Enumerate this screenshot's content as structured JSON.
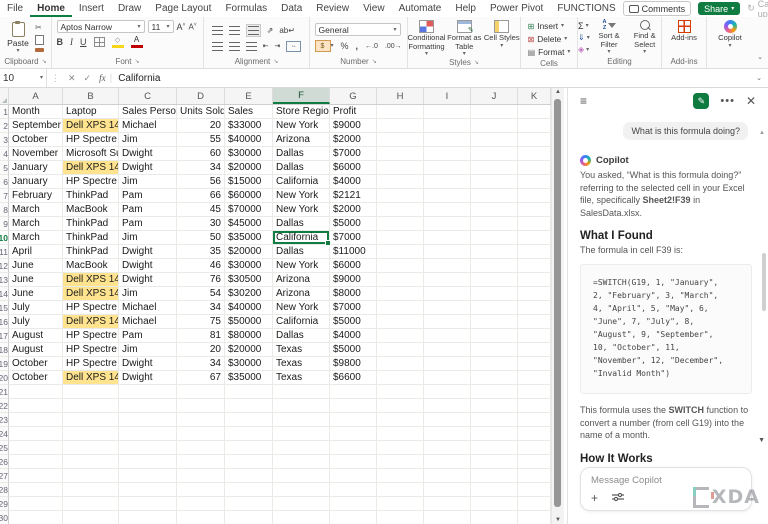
{
  "tabs": {
    "items": [
      "File",
      "Home",
      "Insert",
      "Draw",
      "Page Layout",
      "Formulas",
      "Data",
      "Review",
      "View",
      "Automate",
      "Help",
      "Power Pivot",
      "FUNCTIONS"
    ],
    "active": "Home",
    "comments": "Comments",
    "share": "Share",
    "catch_up": "Catch up"
  },
  "ribbon": {
    "groups": [
      "Clipboard",
      "Font",
      "Alignment",
      "Number",
      "Styles",
      "Cells",
      "Editing",
      "Add-ins"
    ],
    "paste": "Paste",
    "font_name": "Aptos Narrow",
    "font_size": "11",
    "bold": "B",
    "italic": "I",
    "underline": "U",
    "grow_font": "A",
    "shrink_font": "A",
    "number_format": "General",
    "percent": "%",
    "comma": ",",
    "dollar": "$",
    "inc_decimal": ".0",
    "dec_decimal": ".00",
    "conditional_formatting": "Conditional Formatting",
    "format_as_table": "Format as Table",
    "cell_styles": "Cell Styles",
    "insert": "Insert",
    "delete": "Delete",
    "format": "Format",
    "autosum": "Σ",
    "sort_filter": "Sort & Filter",
    "find_select": "Find & Select",
    "addins": "Add-ins",
    "copilot": "Copilot"
  },
  "formula_bar": {
    "name_box": "10",
    "fx": "fx",
    "value": "California"
  },
  "sheet": {
    "column_letters": [
      "A",
      "B",
      "C",
      "D",
      "E",
      "F",
      "G",
      "H",
      "I",
      "J",
      "K"
    ],
    "selected_column": "F",
    "selected_cell": "F10",
    "highlighted_laptop": "Dell XPS 14",
    "highlight_color": "#ffe38f",
    "accent_green": "#107c41",
    "header_row": [
      "Month",
      "Laptop",
      "Sales Person",
      "Units Sold",
      "Sales",
      "Store Region",
      "Profit"
    ],
    "rows": [
      [
        "September",
        "Dell XPS 14",
        "Michael",
        "20",
        "$33000",
        "New York",
        "$9000"
      ],
      [
        "October",
        "HP Spectre",
        "Jim",
        "55",
        "$40000",
        "Arizona",
        "$2000"
      ],
      [
        "November",
        "Microsoft Surface",
        "Dwight",
        "60",
        "$30000",
        "Dallas",
        "$7000"
      ],
      [
        "January",
        "Dell XPS 14",
        "Dwight",
        "34",
        "$20000",
        "Dallas",
        "$6000"
      ],
      [
        "January",
        "HP Spectre",
        "Jim",
        "56",
        "$15000",
        "California",
        "$4000"
      ],
      [
        "February",
        "ThinkPad",
        "Pam",
        "66",
        "$60000",
        "New York",
        "$2121"
      ],
      [
        "March",
        "MacBook",
        "Pam",
        "45",
        "$70000",
        "New York",
        "$2000"
      ],
      [
        "March",
        "ThinkPad",
        "Pam",
        "30",
        "$45000",
        "Dallas",
        "$5000"
      ],
      [
        "March",
        "ThinkPad",
        "Jim",
        "50",
        "$35000",
        "California",
        "$7000"
      ],
      [
        "April",
        "ThinkPad",
        "Dwight",
        "35",
        "$20000",
        "Dallas",
        "$11000"
      ],
      [
        "June",
        "MacBook",
        "Dwight",
        "46",
        "$30000",
        "New York",
        "$6000"
      ],
      [
        "June",
        "Dell XPS 14",
        "Dwight",
        "76",
        "$30500",
        "Arizona",
        "$9000"
      ],
      [
        "June",
        "Dell XPS 14",
        "Jim",
        "54",
        "$30200",
        "Arizona",
        "$8000"
      ],
      [
        "July",
        "HP Spectre",
        "Michael",
        "34",
        "$40000",
        "New York",
        "$7000"
      ],
      [
        "July",
        "Dell XPS 14",
        "Michael",
        "75",
        "$50000",
        "California",
        "$5000"
      ],
      [
        "August",
        "HP Spectre",
        "Pam",
        "81",
        "$80000",
        "Dallas",
        "$4000"
      ],
      [
        "August",
        "HP Spectre",
        "Jim",
        "20",
        "$20000",
        "Texas",
        "$5000"
      ],
      [
        "October",
        "HP Spectre",
        "Dwight",
        "34",
        "$30000",
        "Texas",
        "$9800"
      ],
      [
        "October",
        "Dell XPS 14",
        "Dwight",
        "67",
        "$35000",
        "Texas",
        "$6600"
      ]
    ]
  },
  "copilot_panel": {
    "user_message": "What is this formula doing?",
    "assistant_name": "Copilot",
    "intro_pre": "You asked, “What is this formula doing?” referring to the selected cell in your Excel file, specifically ",
    "intro_bold": "Sheet2!F39",
    "intro_post": " in SalesData.xlsx.",
    "found_title": "What I Found",
    "found_lead": "The formula in cell F39 is:",
    "formula_code": "=SWITCH(G19, 1, \"January\",\n2, \"February\", 3, \"March\",\n4, \"April\", 5, \"May\", 6,\n\"June\", 7, \"July\", 8,\n\"August\", 9, \"September\",\n10, \"October\", 11,\n\"November\", 12, \"December\",\n\"Invalid Month\")",
    "expl_pre": "This formula uses the ",
    "expl_bold": "SWITCH",
    "expl_post": " function to convert a number (from cell G19) into the name of a month.",
    "works_title": "How It Works",
    "input_placeholder": "Message Copilot",
    "watermark": "XDA"
  }
}
